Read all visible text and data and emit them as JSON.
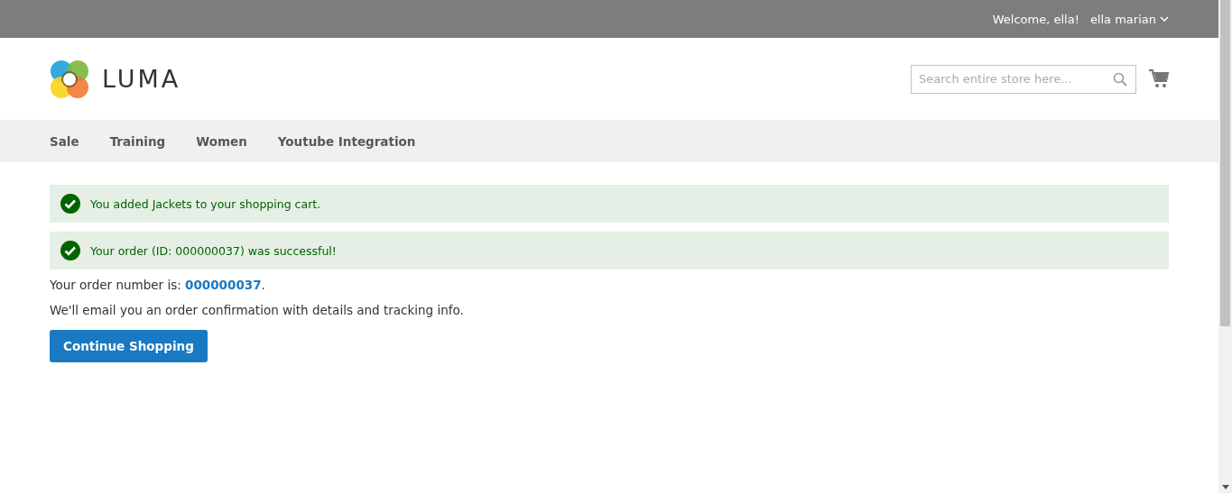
{
  "top_bar": {
    "welcome": "Welcome, ella!",
    "account": {
      "label": "ella marian",
      "expanded": false
    }
  },
  "header": {
    "logo_text": "LUMA",
    "search": {
      "placeholder": "Search entire store here..."
    }
  },
  "nav": [
    {
      "label": "Sale"
    },
    {
      "label": "Training"
    },
    {
      "label": "Women"
    },
    {
      "label": "Youtube Integration"
    }
  ],
  "messages": [
    {
      "kind": "success",
      "text": "You added Jackets to your shopping cart."
    },
    {
      "kind": "success",
      "text": "Your order (ID: 000000037) was successful!"
    }
  ],
  "order": {
    "prefix": "Your order number is: ",
    "number": "000000037",
    "suffix": "."
  },
  "note": "We'll email you an order confirmation with details and tracking info.",
  "button": "Continue Shopping"
}
